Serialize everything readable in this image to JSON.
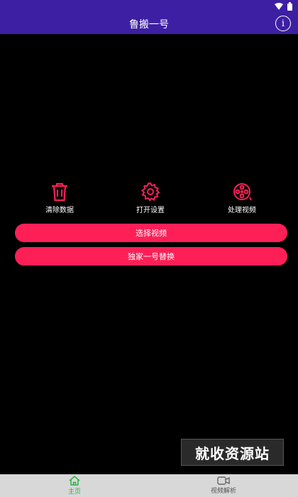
{
  "app": {
    "title": "鲁搬一号",
    "info_glyph": "i"
  },
  "colors": {
    "appbar": "#3d1fa3",
    "accent": "#ff1f57",
    "background": "#000000",
    "nav_active": "#2fb24a"
  },
  "actions": [
    {
      "label": "清除数据",
      "icon": "trash-icon"
    },
    {
      "label": "打开设置",
      "icon": "gear-icon"
    },
    {
      "label": "处理视频",
      "icon": "film-reel-icon"
    }
  ],
  "buttons": {
    "select_video": "选择视频",
    "exclusive_replace": "独家一号替换"
  },
  "watermark": "就收资源站",
  "bottom_nav": [
    {
      "label": "主页",
      "icon": "home-icon",
      "active": true
    },
    {
      "label": "视频解析",
      "icon": "video-camera-icon",
      "active": false
    }
  ]
}
